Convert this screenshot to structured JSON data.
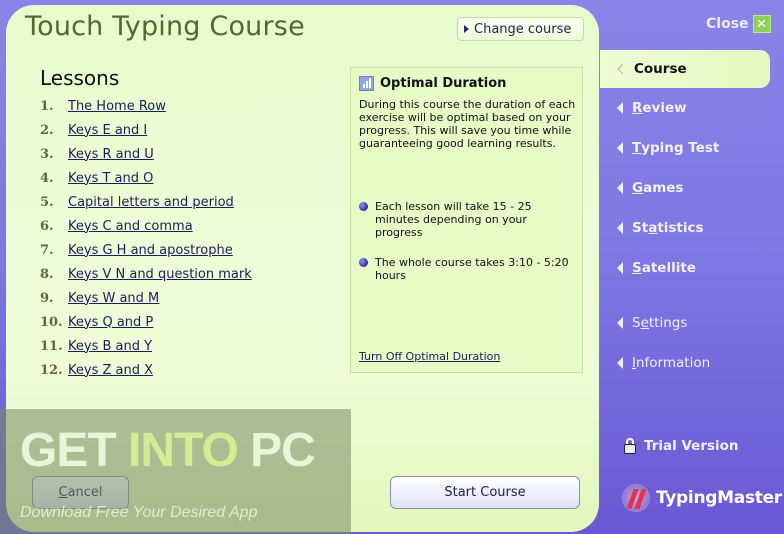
{
  "window": {
    "title": "Touch Typing Course",
    "close_label": "Close",
    "close_icon": "x-icon"
  },
  "header": {
    "change_course_label": "Change course"
  },
  "lessons": {
    "heading": "Lessons",
    "items": [
      {
        "num": "1.",
        "label": "The Home Row"
      },
      {
        "num": "2.",
        "label": "Keys E and I"
      },
      {
        "num": "3.",
        "label": "Keys R and U"
      },
      {
        "num": "4.",
        "label": "Keys T and O"
      },
      {
        "num": "5.",
        "label": "Capital letters and period"
      },
      {
        "num": "6.",
        "label": "Keys C and comma"
      },
      {
        "num": "7.",
        "label": "Keys G H and apostrophe"
      },
      {
        "num": "8.",
        "label": "Keys V N and question mark"
      },
      {
        "num": "9.",
        "label": "Keys W and M"
      },
      {
        "num": "10.",
        "label": "Keys Q and P"
      },
      {
        "num": "11.",
        "label": "Keys B and Y"
      },
      {
        "num": "12.",
        "label": "Keys Z and X"
      }
    ]
  },
  "info_box": {
    "icon": "bar-chart-icon",
    "title": "Optimal Duration",
    "description": "During this course the duration of each exercise will be optimal based on your progress. This will save you time while guaranteeing good learning results.",
    "bullets": [
      "Each lesson will take 15 - 25 minutes depending on your progress",
      "The whole course takes 3:10 - 5:20 hours"
    ],
    "link": "Turn Off Optimal Duration"
  },
  "buttons": {
    "cancel_underline": "C",
    "cancel_rest": "ancel",
    "start": "Start Course"
  },
  "sidebar": {
    "items": [
      {
        "pre": "",
        "u": "",
        "post": "Course",
        "active": true
      },
      {
        "pre": "",
        "u": "R",
        "post": "eview"
      },
      {
        "pre": "",
        "u": "T",
        "post": "yping Test"
      },
      {
        "pre": "",
        "u": "G",
        "post": "ames"
      },
      {
        "pre": "St",
        "u": "a",
        "post": "tistics"
      },
      {
        "pre": "",
        "u": "S",
        "post": "atellite"
      },
      {
        "pre": "S",
        "u": "e",
        "post": "ttings"
      },
      {
        "pre": "",
        "u": "I",
        "post": "nformation"
      }
    ],
    "trial_label": "Trial Version",
    "brand": "TypingMaster"
  },
  "watermark": {
    "part1": "GET ",
    "part2": "INTO",
    "part3": " PC",
    "subtitle": "Download Free Your Desired App"
  },
  "colors": {
    "panel_bg": "#effcd6",
    "sidebar_bg": "#8a84e8",
    "title_green": "#54682f",
    "link_blue": "#1a1f5a"
  }
}
